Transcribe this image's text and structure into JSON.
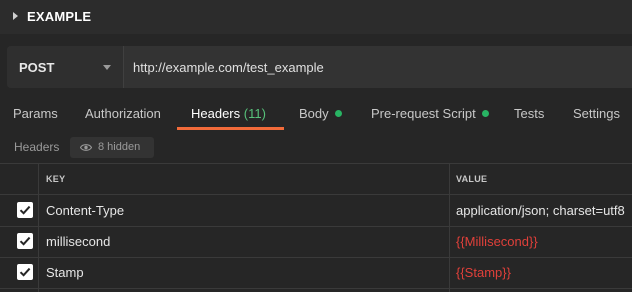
{
  "collection": {
    "name": "EXAMPLE"
  },
  "request": {
    "method": "POST",
    "url": "http://example.com/test_example"
  },
  "tabs": [
    {
      "label": "Params"
    },
    {
      "label": "Authorization"
    },
    {
      "label": "Headers",
      "count": "(11)"
    },
    {
      "label": "Body",
      "indicator": "green-dot"
    },
    {
      "label": "Pre-request Script",
      "indicator": "green-dot"
    },
    {
      "label": "Tests"
    },
    {
      "label": "Settings"
    }
  ],
  "headers_section": {
    "label": "Headers",
    "hidden_label": "8 hidden"
  },
  "table": {
    "columns": [
      "KEY",
      "VALUE"
    ],
    "rows": [
      {
        "checked": true,
        "key": "Content-Type",
        "value": "application/json; charset=utf8"
      },
      {
        "checked": true,
        "key": "millisecond",
        "value": "{{Millisecond}}"
      },
      {
        "checked": true,
        "key": "Stamp",
        "value": "{{Stamp}}"
      }
    ]
  },
  "colors": {
    "accent": "#f26b3a",
    "count": "#57c27a",
    "dot": "#28b463",
    "variable": "#e0403a"
  },
  "icons": [
    "caret-right-icon",
    "chevron-down-icon",
    "eye-icon",
    "checkmark-icon"
  ]
}
